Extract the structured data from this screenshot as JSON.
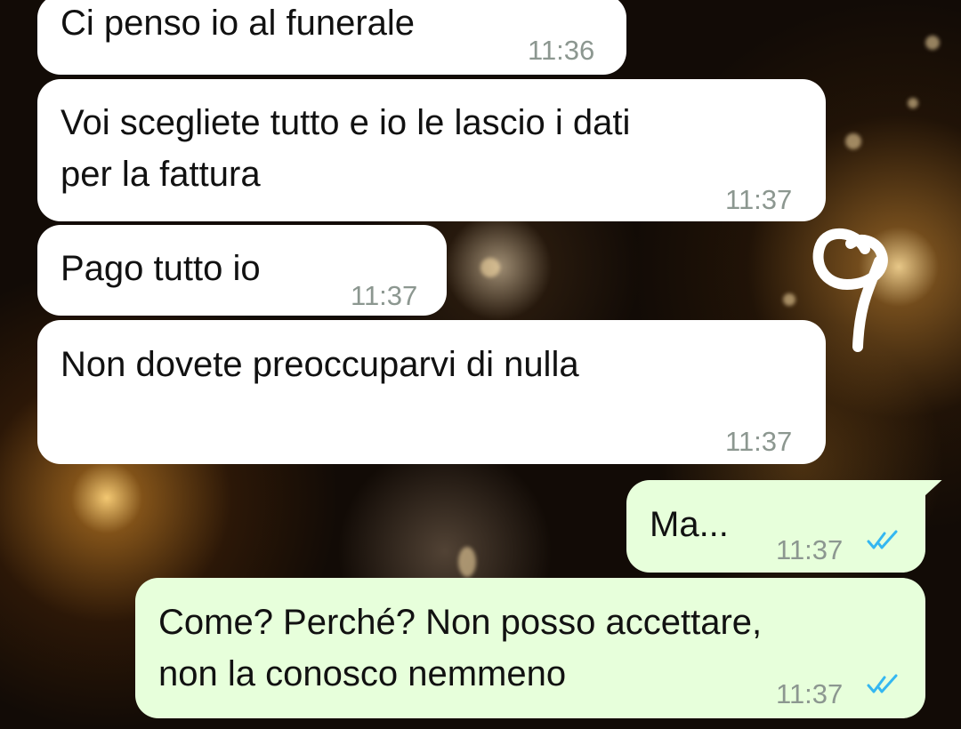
{
  "messages": [
    {
      "direction": "incoming",
      "text": "Ci penso io al funerale",
      "time": "11:36"
    },
    {
      "direction": "incoming",
      "lines": [
        "Voi scegliete tutto e io le lascio i dati",
        "per la fattura"
      ],
      "time": "11:37"
    },
    {
      "direction": "incoming",
      "text": "Pago tutto io",
      "time": "11:37"
    },
    {
      "direction": "incoming",
      "text": "Non dovete preoccuparvi di nulla",
      "time": "11:37"
    },
    {
      "direction": "outgoing",
      "text": "Ma...",
      "time": "11:37",
      "status": "read-double-check-icon"
    },
    {
      "direction": "outgoing",
      "lines": [
        "Come? Perché? Non posso accettare,",
        "non la conosco nemmeno"
      ],
      "time": "11:37",
      "status": "read-double-check-icon"
    }
  ],
  "colors": {
    "incoming_bubble": "#ffffff",
    "outgoing_bubble": "#e7ffdb",
    "timestamp": "#8c9790",
    "read_ticks": "#34b7f1",
    "doodle": "#ffffff"
  }
}
